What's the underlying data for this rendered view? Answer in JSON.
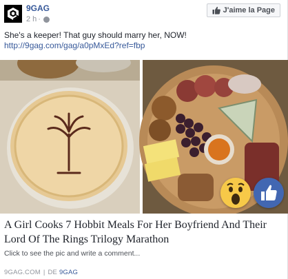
{
  "header": {
    "page_name": "9GAG",
    "timestamp": "2 h",
    "separator": "·",
    "like_page_label": "J'aime la Page"
  },
  "post": {
    "text": "She's a keeper! That guy should marry her, NOW!",
    "link_url": "http://9gag.com/gag/a0pMxEd?ref=fbp"
  },
  "image": {
    "reactions": [
      "wow-icon",
      "like-icon"
    ]
  },
  "link_preview": {
    "title": "A Girl Cooks 7 Hobbit Meals For Her Boyfriend And Their Lord Of The Rings Trilogy Marathon",
    "description": "Click to see the pic and write a comment...",
    "domain": "9GAG.COM",
    "separator": "|",
    "by_label": "DE",
    "source_name": "9GAG"
  },
  "colors": {
    "link_blue": "#365899",
    "meta_gray": "#90949c",
    "like_blue": "#4267b2",
    "wow_yellow": "#f7c948"
  }
}
